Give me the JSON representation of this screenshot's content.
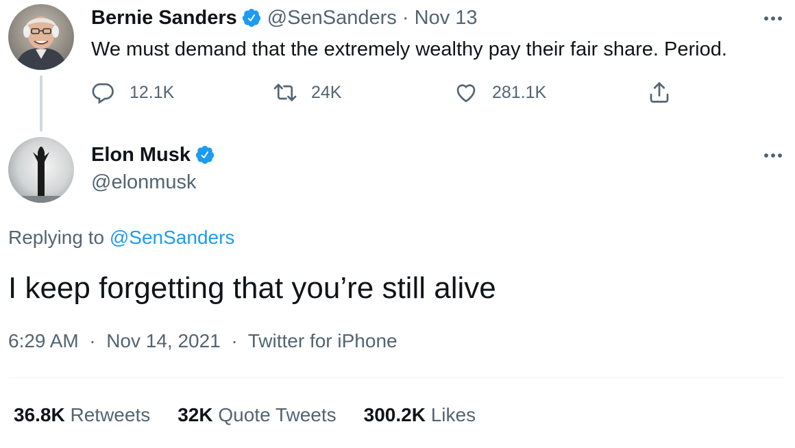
{
  "parent_tweet": {
    "author_name": "Bernie Sanders",
    "handle": "@SenSanders",
    "separator": "·",
    "date": "Nov 13",
    "text": "We must demand that the extremely wealthy pay their fair share. Period.",
    "reply_count": "12.1K",
    "retweet_count": "24K",
    "like_count": "281.1K",
    "icons": [
      "reply-icon",
      "retweet-icon",
      "like-icon",
      "share-icon",
      "more-icon",
      "verified-icon"
    ]
  },
  "reply_tweet": {
    "author_name": "Elon Musk",
    "handle": "@elonmusk",
    "replying_prefix": "Replying to",
    "replying_handle": "@SenSanders",
    "text": "I keep forgetting that you’re still alive",
    "time": "6:29 AM",
    "date": "Nov 14, 2021",
    "source": "Twitter for iPhone",
    "separator": "·",
    "stats": {
      "retweets_value": "36.8K",
      "retweets_label": "Retweets",
      "quotes_value": "32K",
      "quotes_label": "Quote Tweets",
      "likes_value": "300.2K",
      "likes_label": "Likes"
    }
  },
  "colors": {
    "text": "#0f1419",
    "muted": "#536471",
    "link": "#1d9bf0",
    "verified": "#1d9bf0",
    "thread_line": "#cfd9de",
    "divider": "#eff3f4"
  }
}
